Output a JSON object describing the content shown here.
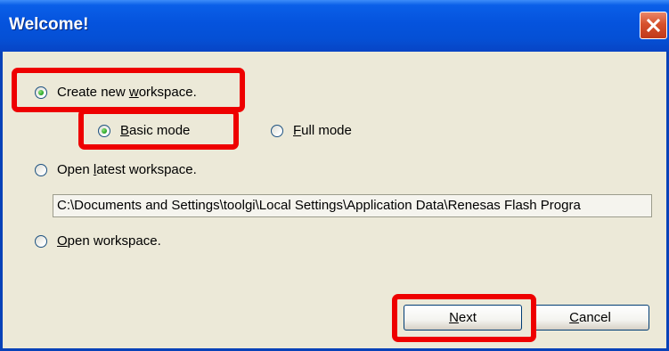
{
  "window": {
    "title": "Welcome!"
  },
  "options": {
    "create_new": {
      "pre": "Create new ",
      "accel": "w",
      "post": "orkspace.",
      "selected": true
    },
    "basic_mode": {
      "pre": "",
      "accel": "B",
      "post": "asic mode",
      "selected": true
    },
    "full_mode": {
      "pre": "",
      "accel": "F",
      "post": "ull mode",
      "selected": false
    },
    "open_latest": {
      "pre": "Open ",
      "accel": "l",
      "post": "atest workspace.",
      "selected": false
    },
    "latest_path": "C:\\Documents and Settings\\toolgi\\Local Settings\\Application Data\\Renesas Flash Progra",
    "open_workspace": {
      "pre": "",
      "accel": "O",
      "post": "pen workspace.",
      "selected": false
    }
  },
  "buttons": {
    "next": {
      "pre": "",
      "accel": "N",
      "post": "ext"
    },
    "cancel": {
      "pre": "",
      "accel": "C",
      "post": "ancel"
    }
  },
  "colors": {
    "title_bar": "#0553dd",
    "dialog_bg": "#ece9d8",
    "highlight": "#ee0000",
    "radio_selected": "#21a121"
  },
  "icons": {
    "close": "close-icon"
  }
}
